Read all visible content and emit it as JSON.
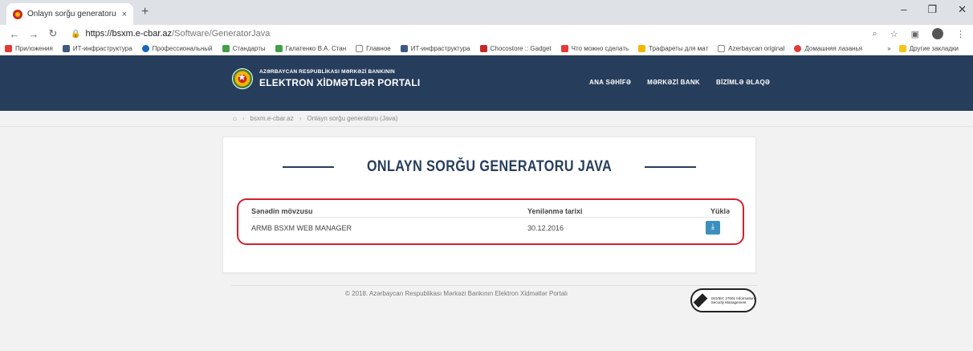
{
  "browser": {
    "tab_title": "Onlayn sorğu generatoru (Java)",
    "tab_close": "×",
    "new_tab": "+",
    "url_host": "https://bsxm.e-cbar.az",
    "url_path": "/Software/GeneratorJava",
    "window_controls": [
      "–",
      "❐",
      "✕"
    ],
    "bookmarks": [
      {
        "label": "Приложения",
        "color": "#e53935"
      },
      {
        "label": "ИТ-инфраструктура",
        "color": "#3d5a80"
      },
      {
        "label": "Профессиональный",
        "color": "#1565c0"
      },
      {
        "label": "Стандарты",
        "color": "#43a047"
      },
      {
        "label": "Галатенко В.А. Стан",
        "color": "#43a047"
      },
      {
        "label": "Главное",
        "color": "#888888"
      },
      {
        "label": "ИТ-инфраструктура",
        "color": "#3d5a80"
      },
      {
        "label": "Chocostore :: Gadget",
        "color": "#c62828"
      },
      {
        "label": "Что можно сделать",
        "color": "#e53935"
      },
      {
        "label": "Трафареты для мат",
        "color": "#f5b400"
      },
      {
        "label": "Azerbaycan original",
        "color": "#888888"
      },
      {
        "label": "Домашняя лазанья",
        "color": "#e53935"
      }
    ],
    "bookmarks_more": "»",
    "other_bookmarks": "Другие закладки"
  },
  "site": {
    "logo_line1": "AZƏRBAYCAN RESPUBLİKASI MƏRKƏZİ BANKININ",
    "logo_line2": "ELEKTRON XİDMƏTLƏR PORTALI",
    "menu": [
      "ANA SƏHİFƏ",
      "MƏRKƏZİ BANK",
      "BİZİMLƏ ƏLAQƏ"
    ]
  },
  "breadcrumb": {
    "home_icon": "⌂",
    "items": [
      "bsxm.e-cbar.az",
      "Onlayn sorğu generatoru (Java)"
    ]
  },
  "page": {
    "title": "ONLAYN SORĞU GENERATORU JAVA",
    "columns": [
      "Sənədin mövzusu",
      "Yenilənmə tarixi",
      "Yüklə"
    ],
    "rows": [
      {
        "topic": "ARMB BSXM WEB MANAGER",
        "date": "30.12.2016"
      }
    ]
  },
  "footer": {
    "text": "© 2018. Azərbaycan Respublikası Mərkəzi Bankının Elektron Xidmətlər Portalı",
    "badge_text": "ISO/IEC 27001 Information Security Management",
    "badge_brand": "bsi."
  },
  "colors": {
    "brand": "#273d5c",
    "highlight": "#d32030",
    "download": "#3b8fbd"
  }
}
